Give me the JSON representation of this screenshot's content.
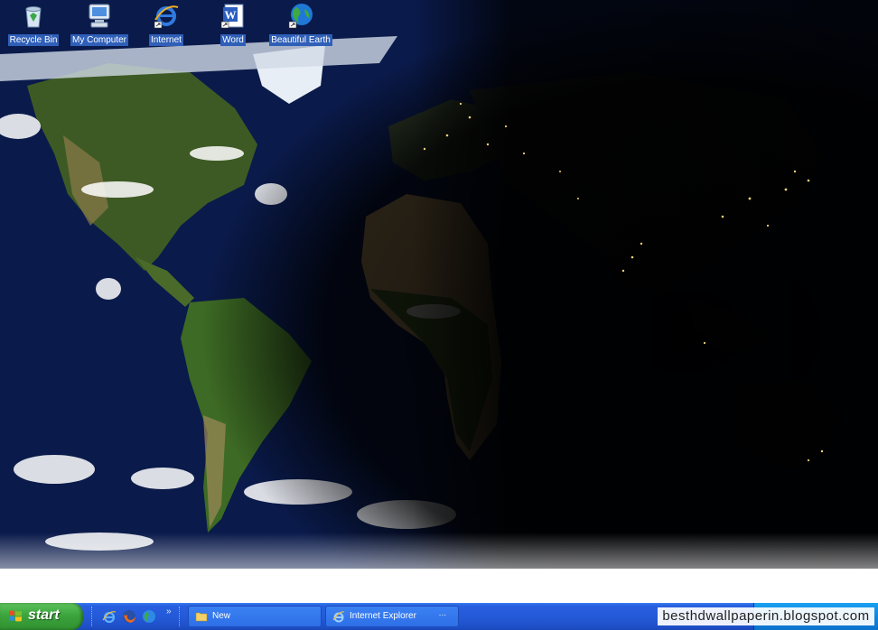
{
  "desktop": {
    "icons": [
      {
        "label": "Recycle Bin",
        "icon": "recycle-bin-icon"
      },
      {
        "label": "My Computer",
        "icon": "my-computer-icon"
      },
      {
        "label": "Internet",
        "icon": "internet-explorer-icon"
      },
      {
        "label": "Word",
        "icon": "word-icon"
      },
      {
        "label": "Beautiful Earth",
        "icon": "globe-icon"
      }
    ]
  },
  "taskbar": {
    "start_label": "start",
    "quick_launch": [
      "internet-explorer-icon",
      "firefox-icon",
      "globe-icon"
    ],
    "quick_launch_more": "»",
    "buttons": [
      {
        "label": "New",
        "icon": "folder-icon"
      },
      {
        "label": "Internet Explorer",
        "icon": "internet-explorer-icon",
        "overflow": "..."
      }
    ]
  },
  "watermark": "besthdwallpaperin.blogspot.com",
  "colors": {
    "taskbar": "#245ad8",
    "start": "#3da53d",
    "tray": "#0f86e0",
    "ocean": "#071338"
  }
}
